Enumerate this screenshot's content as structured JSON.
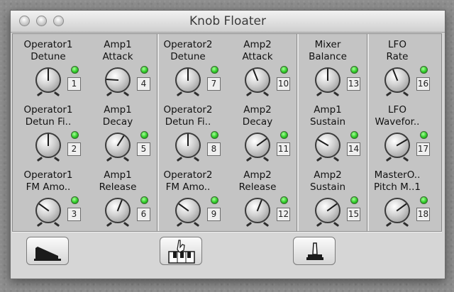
{
  "window": {
    "title": "Knob Floater"
  },
  "knobs": [
    {
      "line1": "Operator1",
      "line2": "Detune",
      "number": "1",
      "value": 0.5
    },
    {
      "line1": "Amp1",
      "line2": "Attack",
      "number": "4",
      "value": 0.18
    },
    {
      "line1": "Operator2",
      "line2": "Detune",
      "number": "7",
      "value": 0.5
    },
    {
      "line1": "Amp2",
      "line2": "Attack",
      "number": "10",
      "value": 0.42
    },
    {
      "line1": "Mixer",
      "line2": "Balance",
      "number": "13",
      "value": 0.5
    },
    {
      "line1": "LFO",
      "line2": "Rate",
      "number": "16",
      "value": 0.42
    },
    {
      "line1": "Operator1",
      "line2": "Detun Fi..",
      "number": "2",
      "value": 0.5
    },
    {
      "line1": "Amp1",
      "line2": "Decay",
      "number": "5",
      "value": 0.62
    },
    {
      "line1": "Operator2",
      "line2": "Detun Fi..",
      "number": "8",
      "value": 0.5
    },
    {
      "line1": "Amp2",
      "line2": "Decay",
      "number": "11",
      "value": 0.7
    },
    {
      "line1": "Amp1",
      "line2": "Sustain",
      "number": "14",
      "value": 0.28
    },
    {
      "line1": "LFO",
      "line2": "Wavefor..",
      "number": "17",
      "value": 0.72
    },
    {
      "line1": "Operator1",
      "line2": "FM Amo..",
      "number": "3",
      "value": 0.3
    },
    {
      "line1": "Amp1",
      "line2": "Release",
      "number": "6",
      "value": 0.58
    },
    {
      "line1": "Operator2",
      "line2": "FM Amo..",
      "number": "9",
      "value": 0.3
    },
    {
      "line1": "Amp2",
      "line2": "Release",
      "number": "12",
      "value": 0.58
    },
    {
      "line1": "Amp2",
      "line2": "Sustain",
      "number": "15",
      "value": 0.7
    },
    {
      "line1": "MasterO..",
      "line2": "Pitch M..1",
      "number": "18",
      "value": 0.7
    }
  ],
  "buttons": [
    {
      "icon": "pedal-icon"
    },
    {
      "icon": "keyboard-hand-icon"
    },
    {
      "icon": "joystick-icon"
    }
  ],
  "colors": {
    "led_green": "#2ecb27",
    "panel": "#c4c4c4"
  }
}
